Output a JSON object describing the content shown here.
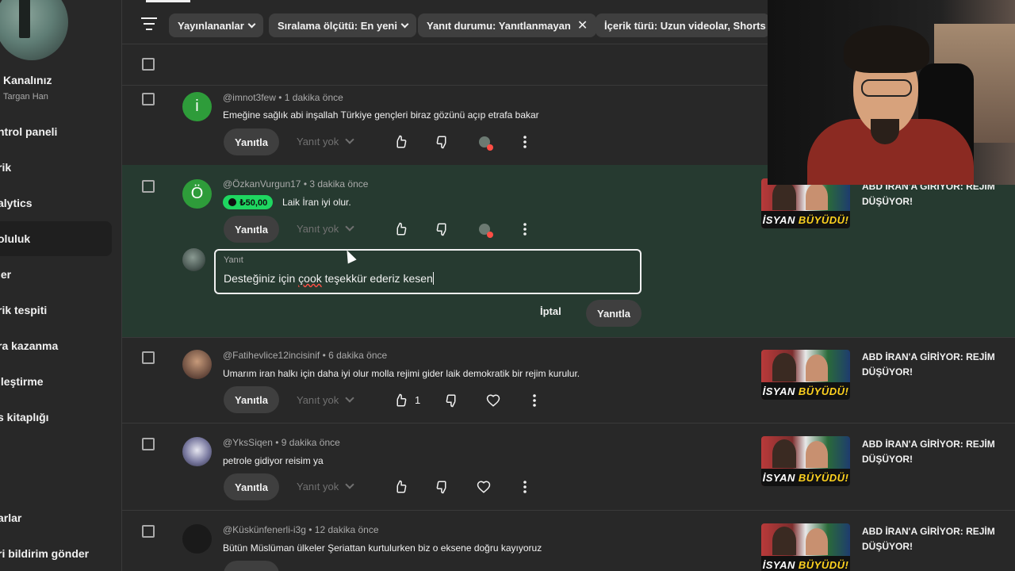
{
  "sidebar": {
    "channel_title": "Kanalınız",
    "channel_subtitle": "Targan Han",
    "items": [
      {
        "label": "ntrol paneli"
      },
      {
        "label": "rik"
      },
      {
        "label": "alytics"
      },
      {
        "label": "oluluk"
      },
      {
        "label": "ler"
      },
      {
        "label": "rik tespiti"
      },
      {
        "label": "ra kazanma"
      },
      {
        "label": "lleştirme"
      },
      {
        "label": "s kitaplığı"
      },
      {
        "label": "arlar"
      },
      {
        "label": "ri bildirim gönder"
      }
    ]
  },
  "filters": {
    "chips": [
      {
        "label": "Yayınlananlar",
        "icon": "chevron-down-icon"
      },
      {
        "label": "Sıralama ölçütü: En yeni",
        "icon": "chevron-down-icon"
      },
      {
        "label": "Yanıt durumu: Yanıtlanmayan",
        "icon": "close-icon"
      },
      {
        "label": "İçerik türü: Uzun videolar, Shorts vi"
      }
    ]
  },
  "common": {
    "reply_label": "Yanıtla",
    "no_reply_label": "Yanıt yok"
  },
  "comments": [
    {
      "avatar_letter": "i",
      "avatar_color": "#2e9c3a",
      "author": "@imnot3few",
      "time": "1 dakika önce",
      "text": "Emeğine sağlık abi inşallah Türkiye gençleri biraz gözünü açıp etrafa bakar",
      "likes": "",
      "creator_heart": true
    },
    {
      "avatar_letter": "Ö",
      "avatar_color": "#2e9c3a",
      "author": "@ÖzkanVurgun17",
      "time": "3 dakika önce",
      "super_thanks": "₺50,00",
      "text": "Laik İran iyi olur.",
      "likes": "",
      "creator_heart": true,
      "video_title": "ABD İRAN'A GİRİYOR: REJİM DÜŞÜYOR!"
    },
    {
      "author": "@Fatihevlice12incisinif",
      "time": "6 dakika önce",
      "text": "Umarım iran halkı için daha iyi olur molla rejimi gider laik demokratik bir rejim kurulur.",
      "likes": "1",
      "video_title": "ABD İRAN'A GİRİYOR: REJİM DÜŞÜYOR!"
    },
    {
      "author": "@YksSiqen",
      "time": "9 dakika önce",
      "text": "petrole gidiyor reisim ya",
      "likes": "",
      "video_title": "ABD İRAN'A GİRİYOR: REJİM DÜŞÜYOR!"
    },
    {
      "author": "@Küskünfenerli-i3g",
      "time": "12 dakika önce",
      "text": "Bütün Müslüman ülkeler Şeriattan kurtulurken biz o eksene doğru kayıyoruz",
      "likes": "",
      "video_title": "ABD İRAN'A GİRİYOR: REJİM DÜŞÜYOR!"
    }
  ],
  "thumbnail": {
    "band_text": "İSYAN",
    "band_highlight": "BÜYÜDÜ!"
  },
  "reply_box": {
    "label": "Yanıt",
    "value_pre": "Desteğiniz için ",
    "value_misspelled": "çook",
    "value_post": " teşekkür ederiz kesen",
    "cancel": "İptal",
    "submit": "Yanıtla"
  },
  "colors": {
    "background": "#282828",
    "highlight_row": "#263a30",
    "super_thanks": "#1ed760",
    "heart": "#ff4e45"
  }
}
